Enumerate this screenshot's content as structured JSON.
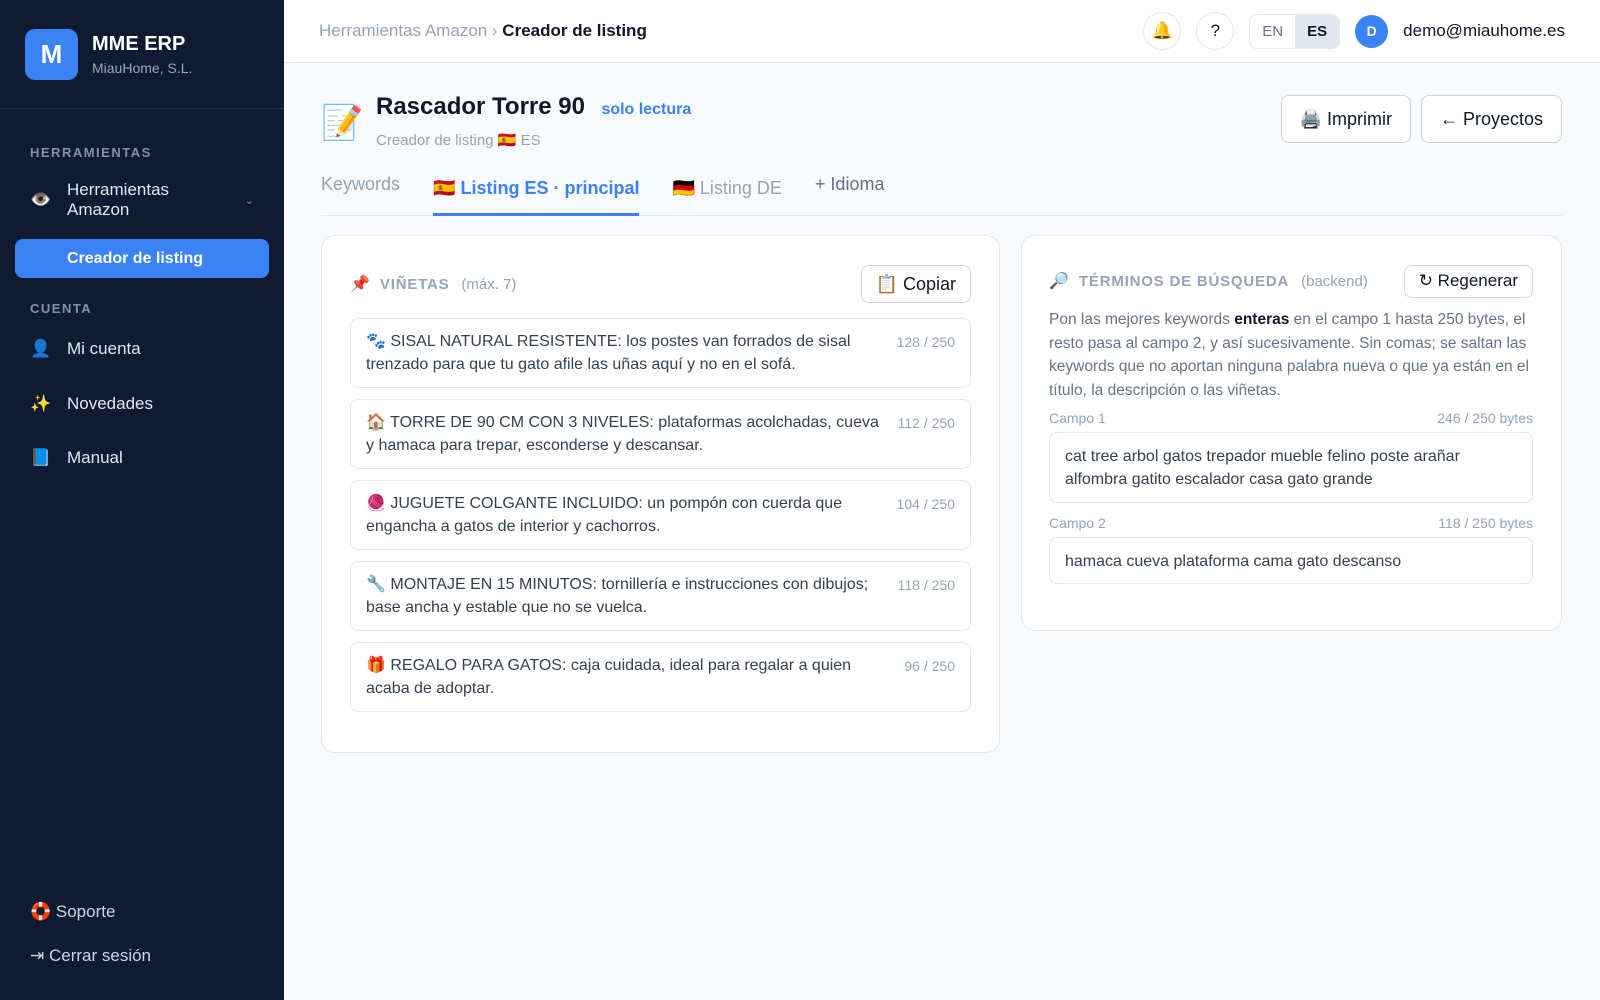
{
  "sidebar": {
    "logo_letter": "M",
    "brand_name": "MME ERP",
    "brand_sub": "MiauHome, S.L.",
    "section_tools": "HERRAMIENTAS",
    "tools_item": {
      "icon": "👁️",
      "label": "Herramientas Amazon"
    },
    "tools_sub": "Creador de listing",
    "section_account": "CUENTA",
    "items": [
      {
        "icon": "👤",
        "label": "Mi cuenta"
      },
      {
        "icon": "✨",
        "label": "Novedades"
      },
      {
        "icon": "📘",
        "label": "Manual"
      }
    ],
    "support": "🛟 Soporte",
    "logout": "⇥ Cerrar sesión"
  },
  "topbar": {
    "crumb_parent": "Herramientas Amazon",
    "crumb_sep": " › ",
    "crumb_current": "Creador de listing",
    "bell": "🔔",
    "help": "?",
    "lang_en": "EN",
    "lang_es": "ES",
    "avatar_letter": "D",
    "email": "demo@miauhome.es"
  },
  "header": {
    "icon": "📝",
    "title": "Rascador Torre 90",
    "readonly": "solo lectura",
    "subtitle": "Creador de listing 🇪🇸 ES",
    "print": "🖨️ Imprimir",
    "projects": "← Proyectos"
  },
  "tabs": [
    {
      "label": "Keywords"
    },
    {
      "label": "🇪🇸 Listing ES · principal"
    },
    {
      "label": "🇩🇪 Listing DE"
    },
    {
      "label": "+ Idioma"
    }
  ],
  "bullets_card": {
    "icon": "📌",
    "title": "VIÑETAS",
    "hint": "(máx. 7)",
    "copy": "📋 Copiar",
    "items": [
      {
        "text": "🐾 SISAL NATURAL RESISTENTE: los postes van forrados de sisal trenzado para que tu gato afile las uñas aquí y no en el sofá.",
        "count": "128 / 250"
      },
      {
        "text": "🏠 TORRE DE 90 CM CON 3 NIVELES: plataformas acolchadas, cueva y hamaca para trepar, esconderse y descansar.",
        "count": "112 / 250"
      },
      {
        "text": "🧶 JUGUETE COLGANTE INCLUIDO: un pompón con cuerda que engancha a gatos de interior y cachorros.",
        "count": "104 / 250"
      },
      {
        "text": "🔧 MONTAJE EN 15 MINUTOS: tornillería e instrucciones con dibujos; base ancha y estable que no se vuelca.",
        "count": "118 / 250"
      },
      {
        "text": "🎁 REGALO PARA GATOS: caja cuidada, ideal para regalar a quien acaba de adoptar.",
        "count": "96 / 250"
      }
    ]
  },
  "search_card": {
    "icon": "🔎",
    "title": "TÉRMINOS DE BÚSQUEDA",
    "hint": "(backend)",
    "regen": "↻ Regenerar",
    "desc_pre": "Pon las mejores keywords ",
    "desc_bold": "enteras",
    "desc_post": " en el campo 1 hasta 250 bytes, el resto pasa al campo 2, y así sucesivamente. Sin comas; se saltan las keywords que no aportan ninguna palabra nueva o que ya están en el título, la descripción o las viñetas.",
    "fields": [
      {
        "label": "Campo 1",
        "bytes": "246 / 250 bytes",
        "value": "cat tree arbol gatos trepador mueble felino poste arañar alfombra gatito escalador casa gato grande"
      },
      {
        "label": "Campo 2",
        "bytes": "118 / 250 bytes",
        "value": "hamaca cueva plataforma cama gato descanso"
      }
    ]
  }
}
